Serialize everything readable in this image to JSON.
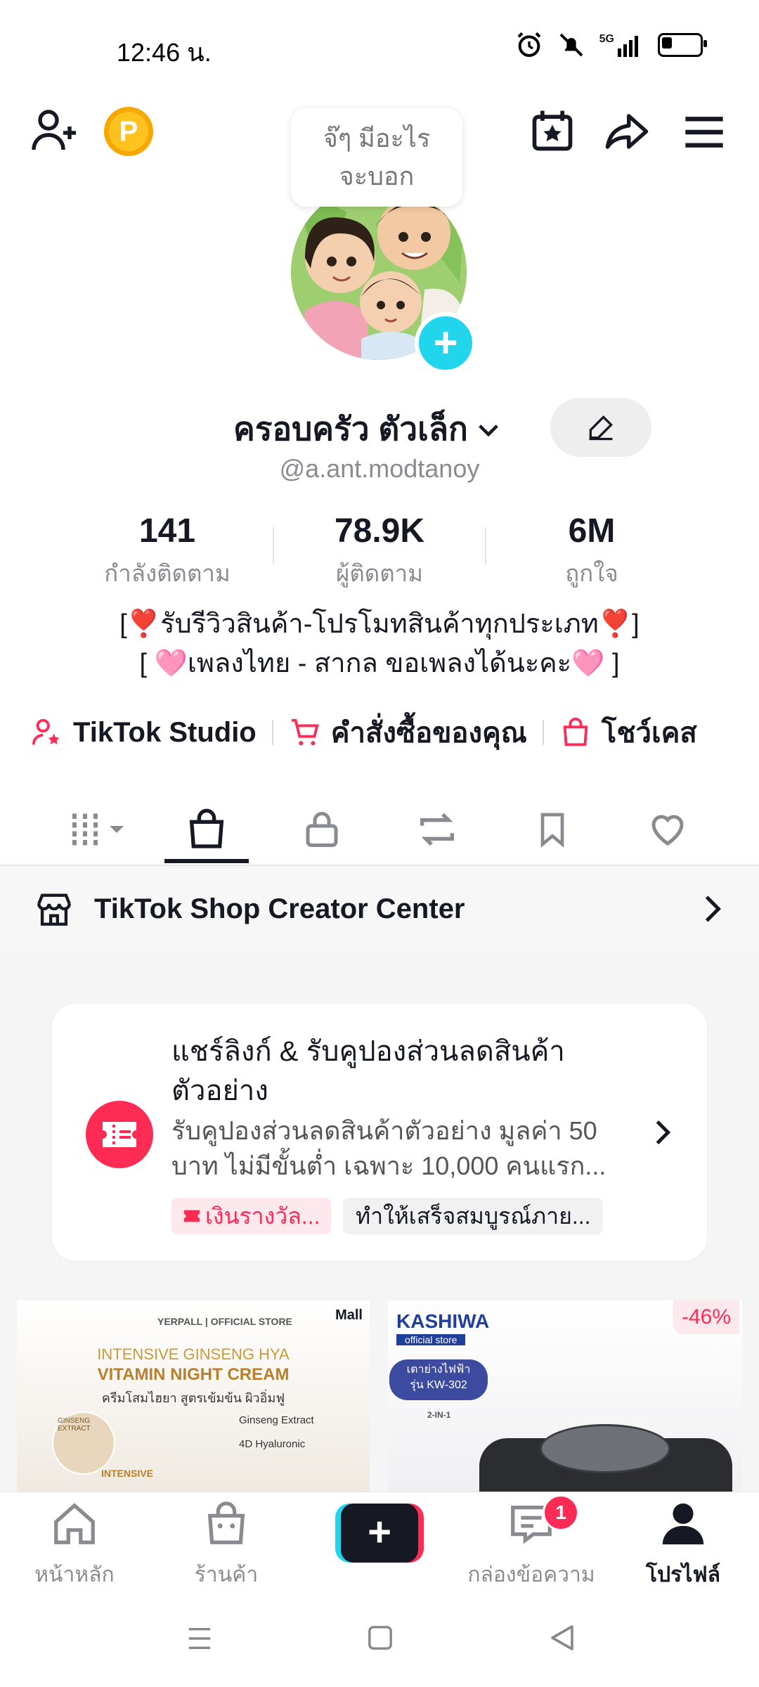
{
  "status": {
    "time": "12:46 น.",
    "network": "5G"
  },
  "header": {
    "bubble_text": "จ๊ๆ มีอะไร จะบอก",
    "coin_letter": "P"
  },
  "profile": {
    "name": "ครอบครัว ตัวเล็ก",
    "handle": "@a.ant.modtanoy",
    "stats": [
      {
        "value": "141",
        "label": "กำลังติดตาม"
      },
      {
        "value": "78.9K",
        "label": "ผู้ติดตาม"
      },
      {
        "value": "6M",
        "label": "ถูกใจ"
      }
    ],
    "bio_line1": "[❣️รับรีวิวสินค้า-โปรโมทสินค้าทุกประเภท❣️]",
    "bio_line2": "[ 🩷เพลงไทย - สากล ขอเพลงได้นะคะ🩷 ]"
  },
  "links": {
    "studio": "TikTok Studio",
    "orders": "คำสั่งซื้อของคุณ",
    "showcase": "โชว์เคส"
  },
  "tabs": [
    "grid-icon",
    "shop-bag-icon",
    "lock-icon",
    "repost-icon",
    "bookmark-icon",
    "heart-icon"
  ],
  "creator_center": {
    "title": "TikTok Shop Creator Center"
  },
  "promo": {
    "title": "แชร์ลิงก์ & รับคูปองส่วนลดสินค้าตัวอย่าง",
    "desc": "รับคูปองส่วนลดสินค้าตัวอย่าง มูลค่า 50 บาท ไม่มีขั้นต่ำ เฉพาะ 10,000 คนแรก...",
    "tag1": "เงินรางวัล...",
    "tag2": "ทำให้เสร็จสมบูรณ์ภาย..."
  },
  "products": [
    {
      "brand": "YERPALL | OFFICIAL STORE",
      "mall": "Mall",
      "line1": "INTENSIVE GINSENG HYA",
      "line2": "VITAMIN NIGHT CREAM",
      "line3": "ครีมโสมไฮยา สูตรเข้มข้น ผิวอิ่มฟู",
      "chip1": "Ginseng Extract",
      "chip2": "4D Hyaluronic",
      "jar_label": "GINSENG EXTRACT",
      "pack": "INTENSIVE"
    },
    {
      "brand": "KASHIWA",
      "brand_sub": "official store",
      "title": "เตาย่างไฟฟ้า",
      "model": "รุ่น KW-302",
      "feature": "2-IN-1",
      "discount": "-46%"
    }
  ],
  "nav": [
    {
      "label": "หน้าหลัก",
      "icon": "home-icon"
    },
    {
      "label": "ร้านค้า",
      "icon": "shop-icon"
    },
    {
      "label": "",
      "icon": "create-plus-icon"
    },
    {
      "label": "กล่องข้อความ",
      "icon": "inbox-icon",
      "badge": "1"
    },
    {
      "label": "โปรไฟล์",
      "icon": "profile-icon"
    }
  ],
  "colors": {
    "accent": "#fe2c55",
    "cyan": "#20d5ec",
    "text": "#161823",
    "muted": "#8a8b91"
  }
}
